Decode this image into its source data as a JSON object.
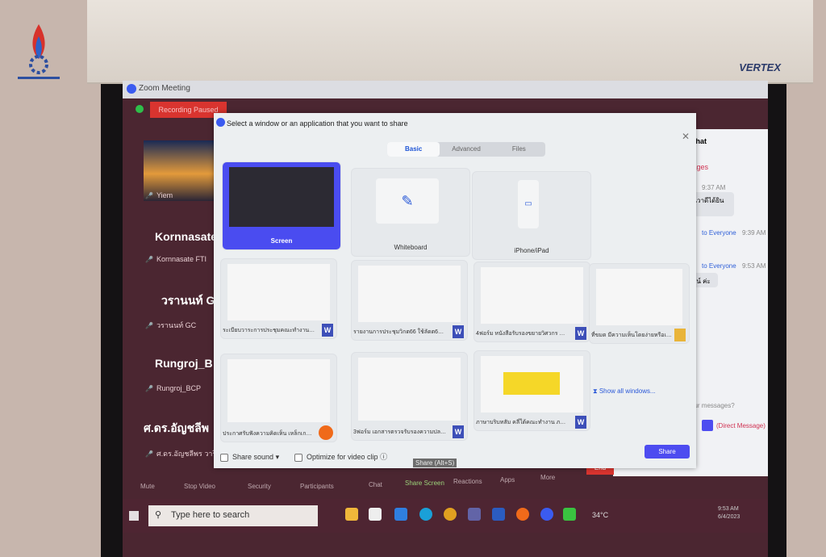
{
  "projector_brand": "VERTEX",
  "zoom": {
    "window_title": "Zoom Meeting",
    "recording_status": "Recording Paused"
  },
  "participants": [
    {
      "display": "",
      "name": "Yiem"
    },
    {
      "display": "Kornnasate",
      "name": "Kornnasate FTI"
    },
    {
      "display": "วรานนท์ G",
      "name": "วรานนท์ GC"
    },
    {
      "display": "Rungroj_B",
      "name": "Rungroj_BCP"
    },
    {
      "display": "ศ.ดร.อัญชลีพ",
      "name": "ศ.ดร.อัญชลีพร วาริท"
    }
  ],
  "dialog": {
    "title": "Select a window or an application that you want to share",
    "tabs": [
      {
        "label": "Basic",
        "active": true
      },
      {
        "label": "Advanced"
      },
      {
        "label": "Files"
      }
    ],
    "tiles": [
      {
        "label": "Screen",
        "selected": true
      },
      {
        "label": "Whiteboard"
      },
      {
        "label": "iPhone/iPad"
      }
    ],
    "windows": [
      {
        "label": "ระเบียบวาระการประชุมคณะทำงานการศึ...",
        "app": "word"
      },
      {
        "label": "รายงานการประชุมวิกต66 ใช้ลัดต66 (ไ...",
        "app": "word"
      },
      {
        "label": "4ฟอร์ม หนังสือรับรองขยายวิศวกร ภาค...",
        "app": "word"
      },
      {
        "label": "ที่ขมด มีความเห็นโดยง่ายหรือเห็นด้วย...",
        "app": "folder"
      },
      {
        "label": "ประกาศรับฟังความคิดเห็น เหล็กเกณฑ์...",
        "app": "firefox"
      },
      {
        "label": "3ฟอร์ม เอกสารตรวจรับรองความปลอด...",
        "app": "word"
      },
      {
        "label": "ภาษาบริบทสัม คลี่ใต้คณะทำงาน ภาค...",
        "app": "word"
      }
    ],
    "show_all": "Show all windows...",
    "share_sound": "Share sound",
    "optimize": "Optimize for video clip",
    "share_button": "Share"
  },
  "chat": {
    "title": "Chat",
    "messages_label": "sages",
    "items": [
      {
        "to": "to Everyone",
        "time": "9:37 AM",
        "text": "านวาดีได้ยิน"
      },
      {
        "to": "to Everyone",
        "time": "9:39 AM",
        "text": ""
      },
      {
        "to": "to Everyone",
        "time": "9:53 AM",
        "text": "าสน์ ค่ะ"
      }
    ],
    "input_placeholder": "our messages?",
    "direct_message": "(Direct Message)"
  },
  "toolbar": [
    "Mute",
    "Stop Video",
    "Security",
    "Participants",
    "Chat",
    "Share Screen",
    "Reactions",
    "Apps",
    "More"
  ],
  "end_button": "End",
  "tooltip": "Share (Alt+S)",
  "taskbar": {
    "search_placeholder": "Type here to search",
    "temperature": "34°C",
    "time": "9:53 AM",
    "date": "6/4/2023"
  }
}
